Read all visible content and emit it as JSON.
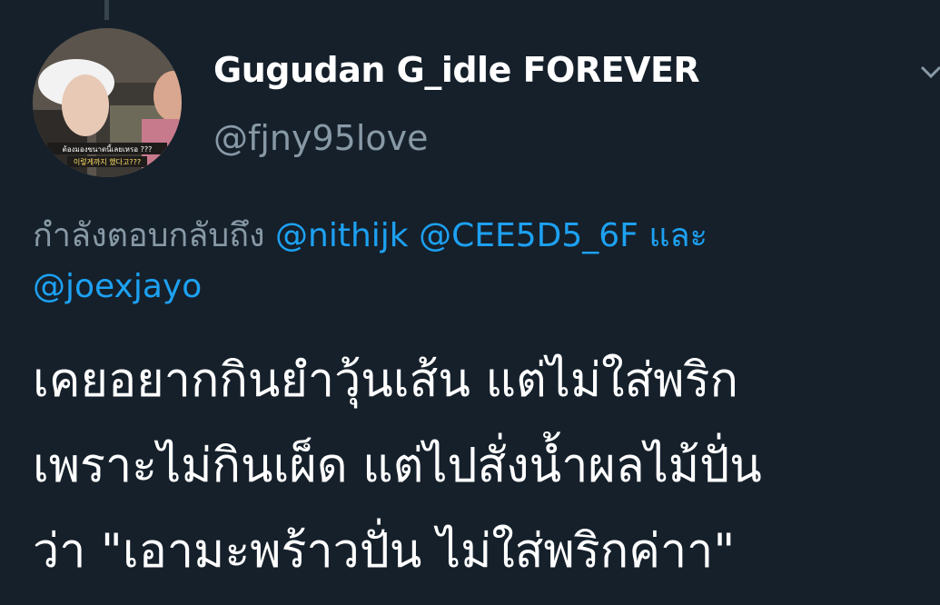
{
  "user": {
    "display_name": "Gugudan G_idle FOREVER",
    "handle": "@fjny95love",
    "avatar_caption_1": "ต้องมองขนาดนี้เลยเหรอ ???",
    "avatar_caption_2": "이렇게까지 했다고???"
  },
  "reply_context": {
    "prefix": "กำลังตอบกลับถึง",
    "mentions": [
      "@nithijk",
      "@CEE5D5_6F",
      "@joexjayo"
    ],
    "conjunction": "และ"
  },
  "tweet": {
    "lines": [
      "เคยอยากกินยำวุ้นเส้น แต่ไม่ใส่พริก",
      "เพราะไม่กินเผ็ด แต่ไปสั่งน้ำผลไม้ปั่น",
      "ว่า \"เอามะพร้าวปั่น ไม่ใส่พริกค่าา\""
    ]
  },
  "icons": {
    "menu": "chevron-down-icon"
  },
  "colors": {
    "background": "#15202b",
    "primary_text": "#ffffff",
    "secondary_text": "#8899a6",
    "link": "#1da1f2"
  }
}
